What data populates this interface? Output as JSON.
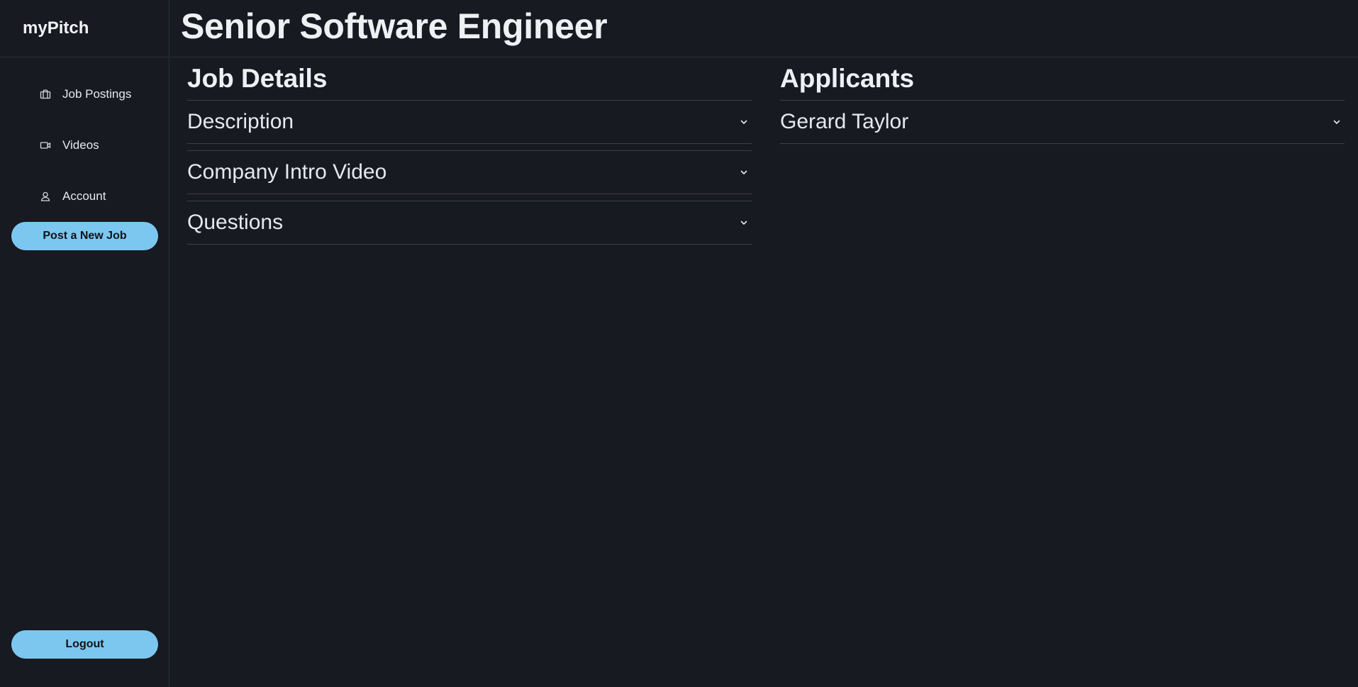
{
  "app": {
    "brand": "myPitch"
  },
  "sidebar": {
    "items": [
      {
        "label": "Job Postings",
        "icon": "briefcase-icon"
      },
      {
        "label": "Videos",
        "icon": "video-camera-icon"
      },
      {
        "label": "Account",
        "icon": "user-icon"
      }
    ],
    "post_job_label": "Post a New Job",
    "logout_label": "Logout"
  },
  "page": {
    "title": "Senior Software Engineer"
  },
  "job_details": {
    "title": "Job Details",
    "sections": [
      {
        "label": "Description"
      },
      {
        "label": "Company Intro Video"
      },
      {
        "label": "Questions"
      }
    ]
  },
  "applicants": {
    "title": "Applicants",
    "list": [
      {
        "name": "Gerard Taylor"
      }
    ]
  },
  "colors": {
    "background": "#171a21",
    "accent": "#7cc7ef",
    "text": "#e6e8ec",
    "divider": "#2b2f38"
  }
}
